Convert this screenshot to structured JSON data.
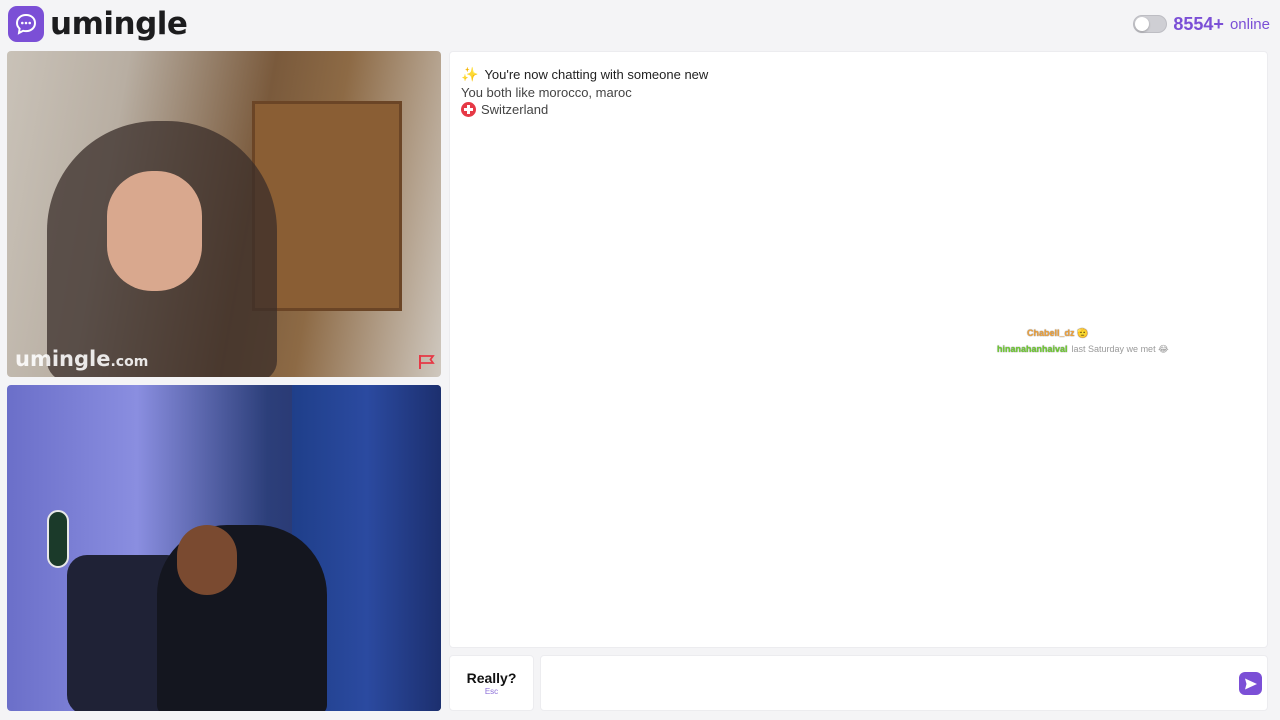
{
  "header": {
    "brand_name": "umingle",
    "online_count": "8554+",
    "online_label": "online"
  },
  "videos": {
    "watermark_main": "umingle",
    "watermark_suffix": ".com"
  },
  "chat": {
    "status_text": "You're now chatting with someone new",
    "common_interests": "You both like morocco, maroc",
    "country": "Switzerland",
    "overlay": {
      "user1": "Chabell_dz",
      "user1_emoji": "🫡",
      "user2": "hinanahanhaival",
      "message": "last Saturday we met 😂"
    }
  },
  "controls": {
    "skip_label": "Really?",
    "skip_hint": "Esc",
    "message_placeholder": ""
  },
  "colors": {
    "accent": "#7b4fd6",
    "flag_red": "#e63946"
  },
  "icons": {
    "brand": "chat-bubble-icon",
    "report": "flag-icon",
    "send": "send-icon",
    "sparkle": "sparkle-icon"
  }
}
